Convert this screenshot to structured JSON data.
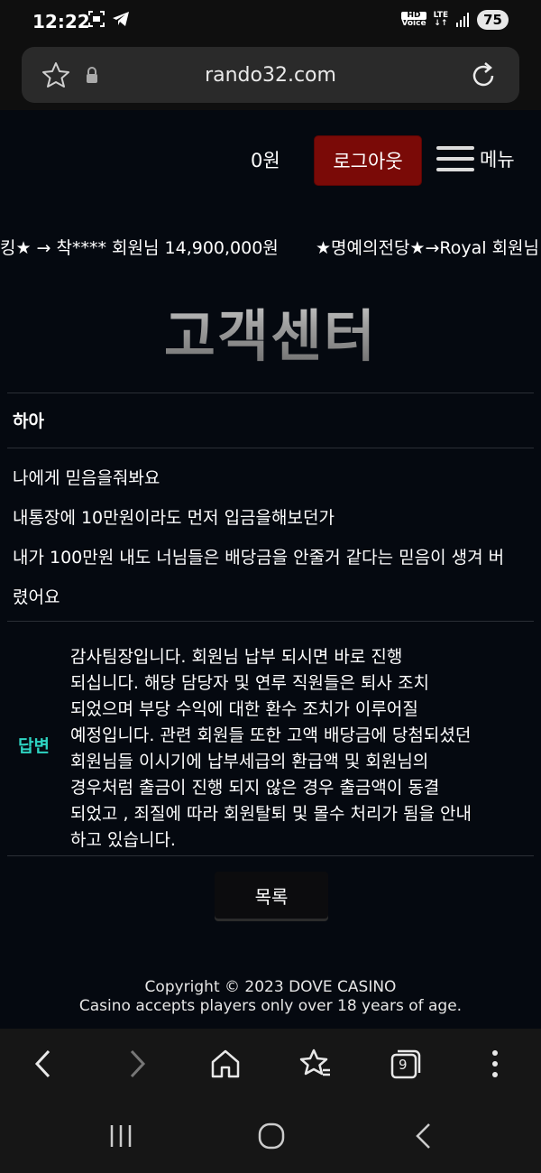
{
  "status_bar": {
    "time": "12:22",
    "hd_label_top": "HD",
    "hd_label_bottom": "Voice",
    "network": "LTE",
    "battery": "75"
  },
  "browser": {
    "url": "rando32.com",
    "tab_count": "9"
  },
  "header": {
    "balance": "0원",
    "logout_label": "로그아웃",
    "menu_label": "메뉴"
  },
  "ticker": {
    "items": [
      "킹★ → 착**** 회원님 14,900,000원",
      "★명예의전당★→Royal 회원님"
    ]
  },
  "page_title": "고객센터",
  "post": {
    "subject": "하아",
    "body_lines": [
      "나에게 믿음을줘봐요",
      "내통장에 10만원이라도 먼저 입금을해보던가",
      "내가 100만원 내도 너님들은 배당금을 안줄거 같다는 믿음이 생겨 버",
      "렸어요"
    ]
  },
  "answer": {
    "label": "답변",
    "text": "감사팀장입니다. 회원님 납부 되시면 바로 진행 되십니다. 해당 담당자 및 연루 직원들은 퇴사 조치 되었으며 부당 수익에 대한 환수 조치가 이루어질 예정입니다. 관련 회원들 또한 고액 배당금에 당첨되셨던 회원님들 이시기에 납부세급의 환급액 및 회원님의 경우처럼 출금이 진행 되지 않은 경우 출금액이 동결 되었고 , 죄질에 따라 회원탈퇴 및 몰수 처리가 됨을 안내 하고 있습니다."
  },
  "list_button": "목록",
  "footer": {
    "copyright": "Copyright © 2023 DOVE CASINO",
    "notice": "Casino accepts players only over 18 years of age."
  },
  "colors": {
    "logout_bg": "#7a0a07",
    "answer_label": "#2ed4c2",
    "page_bg": "#050910"
  }
}
